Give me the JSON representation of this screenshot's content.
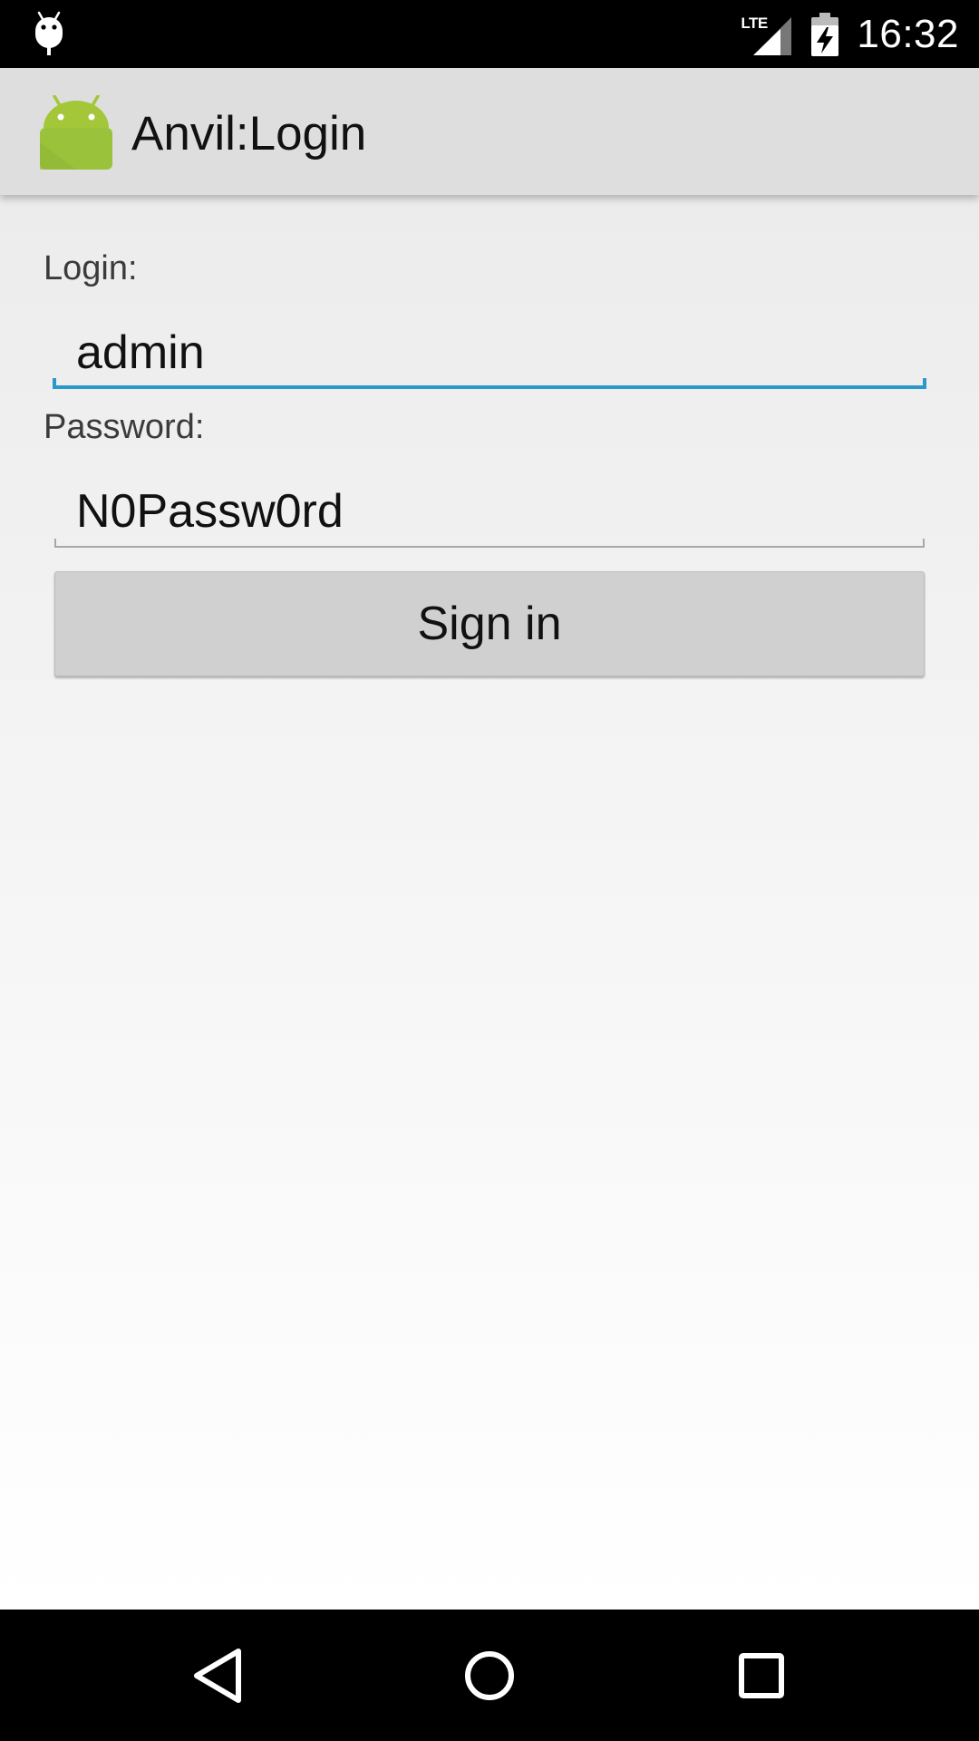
{
  "status_bar": {
    "time": "16:32",
    "network_label": "LTE",
    "left_icon": "android-debug-icon",
    "signal_icon": "signal-icon",
    "battery_icon": "battery-charging-icon"
  },
  "app_bar": {
    "title": "Anvil:Login",
    "icon": "android-launcher-icon",
    "icon_color": "#a4c639"
  },
  "form": {
    "login_label": "Login:",
    "login_value": "admin",
    "password_label": "Password:",
    "password_value": "N0Passw0rd",
    "signin_label": "Sign in",
    "focus_color": "#2a98c8"
  },
  "nav_bar": {
    "back_icon": "back-triangle-icon",
    "home_icon": "home-circle-icon",
    "recents_icon": "recents-square-icon"
  }
}
